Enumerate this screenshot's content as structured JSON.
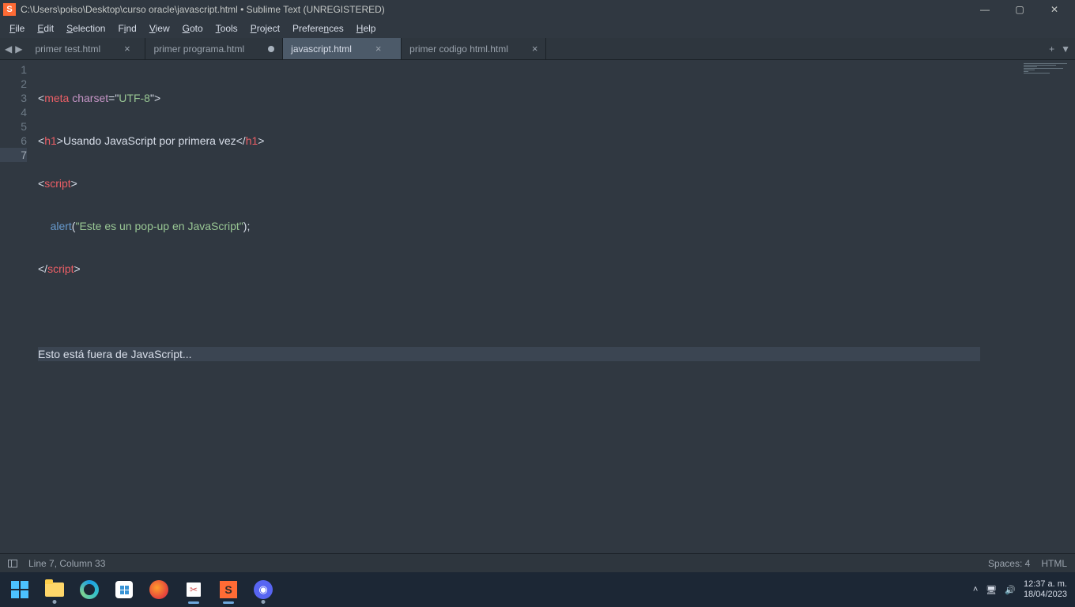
{
  "titlebar": {
    "title": "C:\\Users\\poiso\\Desktop\\curso oracle\\javascript.html • Sublime Text (UNREGISTERED)"
  },
  "menu": {
    "file": "File",
    "edit": "Edit",
    "selection": "Selection",
    "find": "Find",
    "view": "View",
    "goto": "Goto",
    "tools": "Tools",
    "project": "Project",
    "preferences": "Preferences",
    "help": "Help"
  },
  "tabs": [
    {
      "label": "primer test.html",
      "dirty": false,
      "active": false
    },
    {
      "label": "primer programa.html",
      "dirty": true,
      "active": false
    },
    {
      "label": "javascript.html",
      "dirty": false,
      "active": true
    },
    {
      "label": "primer codigo html.html",
      "dirty": false,
      "active": false
    }
  ],
  "gutter": [
    "1",
    "2",
    "3",
    "4",
    "5",
    "6",
    "7"
  ],
  "code": {
    "l1": {
      "p1": "<",
      "tag": "meta",
      "sp": " ",
      "attr": "charset",
      "eq": "=",
      "q1": "\"",
      "val": "UTF-8",
      "q2": "\"",
      "p2": ">"
    },
    "l2": {
      "p1": "<",
      "tag": "h1",
      "p2": ">",
      "text": "Usando JavaScript por primera vez",
      "p3": "</",
      "tag2": "h1",
      "p4": ">"
    },
    "l3": {
      "p1": "<",
      "tag": "script",
      "p2": ">"
    },
    "l4": {
      "indent": "    ",
      "fn": "alert",
      "p1": "(",
      "q1": "\"",
      "str": "Este es un pop-up en JavaScript",
      "q2": "\"",
      "p2": ");"
    },
    "l5": {
      "p1": "</",
      "tag": "script",
      "p2": ">"
    },
    "l7": {
      "text": "Esto está fuera de JavaScript..."
    }
  },
  "status": {
    "position": "Line 7, Column 33",
    "spaces": "Spaces: 4",
    "syntax": "HTML"
  },
  "tabctl": {
    "plus": "+",
    "down": "▼"
  },
  "tray": {
    "time": "12:37 a. m.",
    "date": "18/04/2023",
    "chevron": "˄"
  }
}
